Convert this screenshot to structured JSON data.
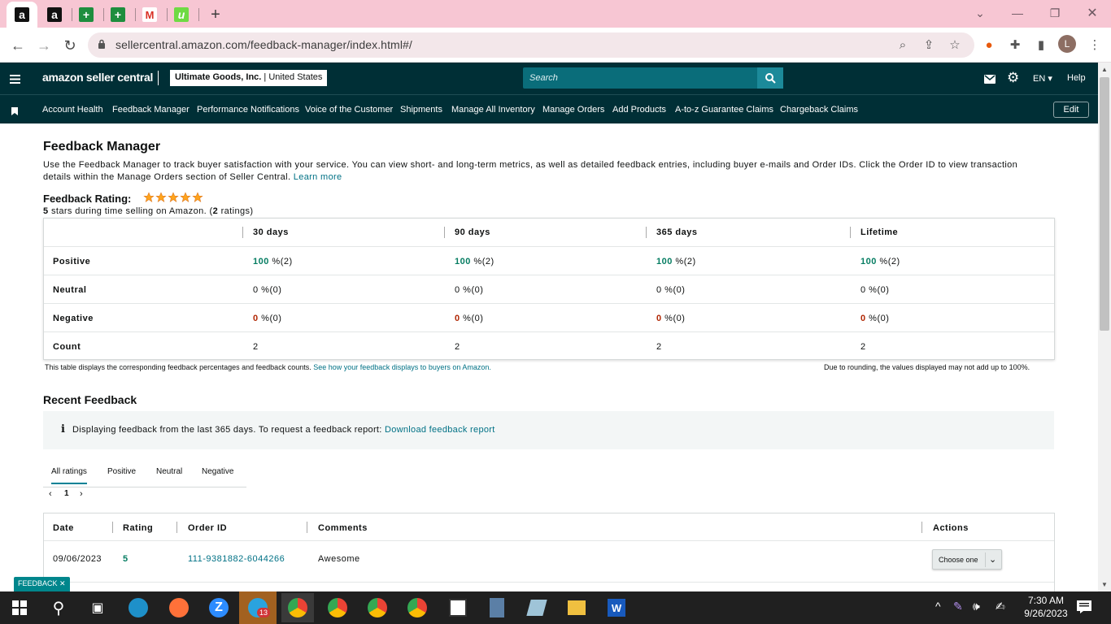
{
  "browser": {
    "tabs": [
      {
        "icon": "amazon-icon",
        "label": "a"
      },
      {
        "icon": "amazon-icon",
        "label": "a"
      },
      {
        "icon": "green-plus-icon",
        "label": "+"
      },
      {
        "icon": "green-plus-icon",
        "label": "+"
      },
      {
        "icon": "gmail-icon",
        "label": "M"
      },
      {
        "icon": "upwork-icon",
        "label": "u"
      }
    ],
    "new_tab": "+",
    "url": "sellercentral.amazon.com/feedback-manager/index.html#/",
    "profile_initial": "L"
  },
  "header": {
    "logo": "amazon seller central",
    "account": "Ultimate Goods, Inc.",
    "marketplace": "United States",
    "search_placeholder": "Search",
    "language": "EN",
    "help": "Help"
  },
  "nav": {
    "items": [
      "Account Health",
      "Feedback Manager",
      "Performance Notifications",
      "Voice of the Customer",
      "Shipments",
      "Manage All Inventory",
      "Manage Orders",
      "Add Products",
      "A-to-z Guarantee Claims",
      "Chargeback Claims"
    ],
    "edit": "Edit"
  },
  "page": {
    "title": "Feedback Manager",
    "description_1": "Use the Feedback Manager to track buyer satisfaction with your service. You can view short- and long-term metrics, as well as detailed feedback entries, including buyer e-mails and Order IDs. Click the Order ID to view transaction",
    "description_2": "details within the Manage Orders section of Seller Central.",
    "learn_more": "Learn more",
    "rating_label": "Feedback Rating:",
    "rating_stars": 5,
    "rating_sub_1": "5",
    "rating_sub_2": " stars during time selling on Amazon. (",
    "rating_sub_3": "2",
    "rating_sub_4": " ratings)"
  },
  "rating_table": {
    "columns": [
      "30 days",
      "90 days",
      "365 days",
      "Lifetime"
    ],
    "rows": [
      {
        "label": "Positive",
        "cells": [
          [
            "100",
            " %(2)"
          ],
          [
            "100",
            " %(2)"
          ],
          [
            "100",
            " %(2)"
          ],
          [
            "100",
            " %(2)"
          ]
        ]
      },
      {
        "label": "Neutral",
        "cells": [
          [
            "0",
            " %(0)"
          ],
          [
            "0",
            " %(0)"
          ],
          [
            "0",
            " %(0)"
          ],
          [
            "0",
            " %(0)"
          ]
        ]
      },
      {
        "label": "Negative",
        "cells": [
          [
            "0",
            " %(0)"
          ],
          [
            "0",
            " %(0)"
          ],
          [
            "0",
            " %(0)"
          ],
          [
            "0",
            " %(0)"
          ]
        ]
      },
      {
        "label": "Count",
        "cells": [
          [
            "2",
            ""
          ],
          [
            "2",
            ""
          ],
          [
            "2",
            ""
          ],
          [
            "2",
            ""
          ]
        ]
      }
    ],
    "footnote": "This table displays the corresponding feedback percentages and feedback counts.",
    "footnote_link": "See how your feedback displays to buyers on Amazon.",
    "rounding_note": "Due to rounding, the values displayed may not add up to 100%."
  },
  "recent": {
    "title": "Recent Feedback",
    "info": "Displaying feedback from the last 365 days. To request a feedback report:",
    "info_link": "Download feedback report",
    "tabs": [
      "All ratings",
      "Positive",
      "Neutral",
      "Negative"
    ],
    "page": "1",
    "columns": [
      "Date",
      "Rating",
      "Order ID",
      "Comments",
      "Actions"
    ],
    "rows": [
      {
        "date": "09/06/2023",
        "rating": "5",
        "order_id": "111-9381882-6044266",
        "comment": "Awesome",
        "action": "Choose one"
      }
    ]
  },
  "feedback_tab": "FEEDBACK ✕",
  "taskbar": {
    "time": "7:30 AM",
    "date": "9/26/2023",
    "badge": "13"
  }
}
